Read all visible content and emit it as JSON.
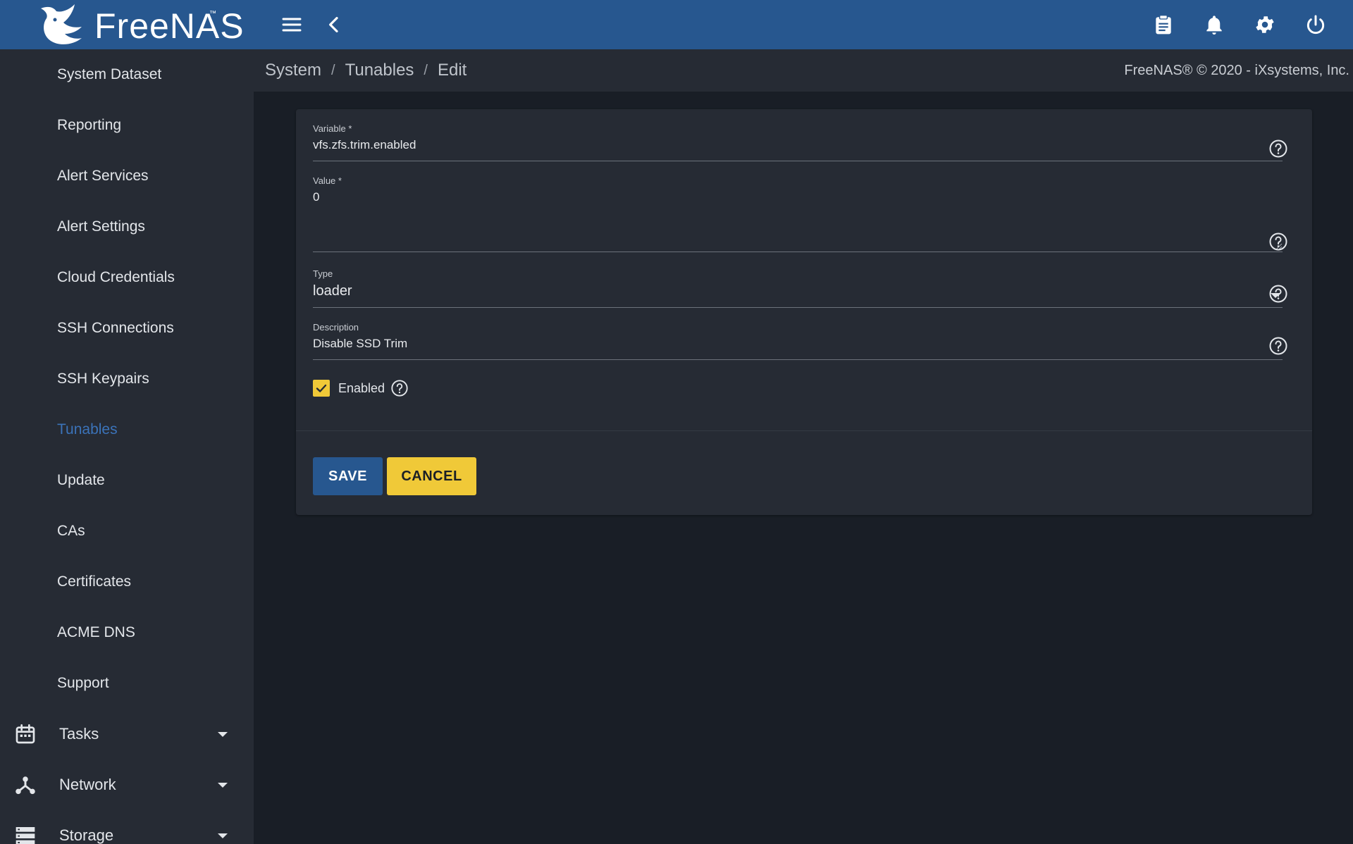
{
  "app": {
    "logo_text": "FreeNAS",
    "logo_tm": "™",
    "copyright": "FreeNAS® © 2020 - iXsystems, Inc."
  },
  "colors": {
    "topbar": "#27578f",
    "sidebar": "#262b34",
    "content_bg": "#191e26",
    "accent_blue": "#3b73b9",
    "accent_yellow": "#f0c938"
  },
  "topbar": {
    "icons": [
      "menu-icon",
      "chevron-left-icon",
      "clipboard-icon",
      "bell-icon",
      "gear-icon",
      "power-icon"
    ]
  },
  "sidebar": {
    "items": [
      {
        "label": "System Dataset"
      },
      {
        "label": "Reporting"
      },
      {
        "label": "Alert Services"
      },
      {
        "label": "Alert Settings"
      },
      {
        "label": "Cloud Credentials"
      },
      {
        "label": "SSH Connections"
      },
      {
        "label": "SSH Keypairs"
      },
      {
        "label": "Tunables",
        "active": true
      },
      {
        "label": "Update"
      },
      {
        "label": "CAs"
      },
      {
        "label": "Certificates"
      },
      {
        "label": "ACME DNS"
      },
      {
        "label": "Support"
      }
    ],
    "groups": [
      {
        "label": "Tasks",
        "icon": "calendar-icon"
      },
      {
        "label": "Network",
        "icon": "network-icon"
      },
      {
        "label": "Storage",
        "icon": "storage-icon"
      }
    ]
  },
  "breadcrumb": {
    "items": [
      "System",
      "Tunables",
      "Edit"
    ],
    "separator": "/"
  },
  "form": {
    "variable": {
      "label": "Variable *",
      "value": "vfs.zfs.trim.enabled"
    },
    "value": {
      "label": "Value *",
      "value": "0"
    },
    "type": {
      "label": "Type",
      "value": "loader"
    },
    "description": {
      "label": "Description",
      "value": "Disable SSD Trim"
    },
    "enabled": {
      "label": "Enabled",
      "checked": true
    },
    "save_label": "SAVE",
    "cancel_label": "CANCEL"
  }
}
